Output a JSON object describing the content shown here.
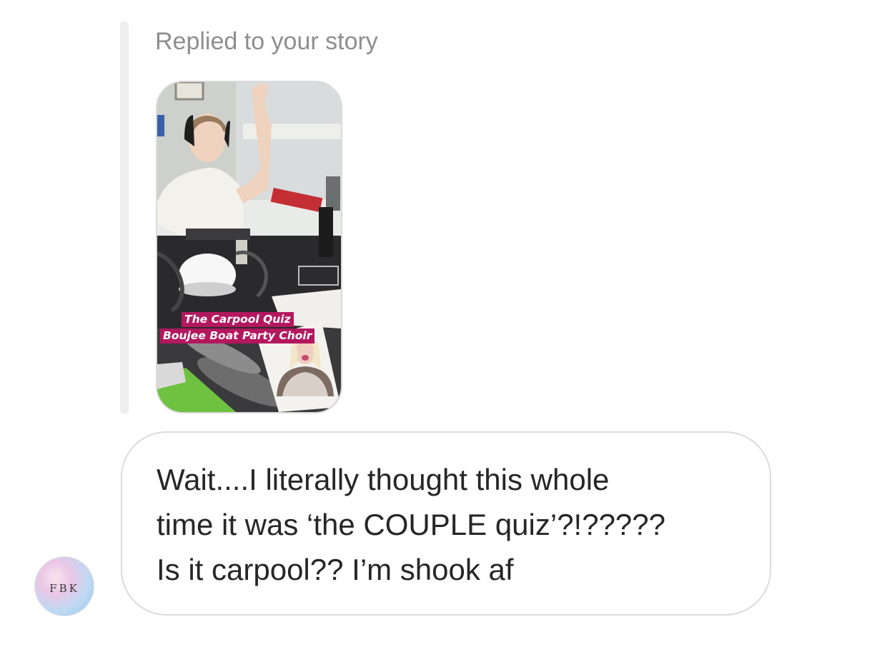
{
  "reply": {
    "label": "Replied to your story"
  },
  "story": {
    "caption_line1": "The Carpool Quiz",
    "caption_line2": "Boujee Boat Party Choir",
    "colors": {
      "caption_bg": "#b3185f",
      "caption_text": "#ffffff"
    }
  },
  "message": {
    "text": "Wait....I literally thought this whole\ntime it was ‘the COUPLE quiz’?!?????\nIs it carpool?? I’m shook af"
  },
  "avatar": {
    "initials": "FBK"
  },
  "colors": {
    "reply_label": "#8e8e8e",
    "bubble_border": "#dbdbdb",
    "message_text": "#262626",
    "reply_bar": "#eeeeee"
  }
}
